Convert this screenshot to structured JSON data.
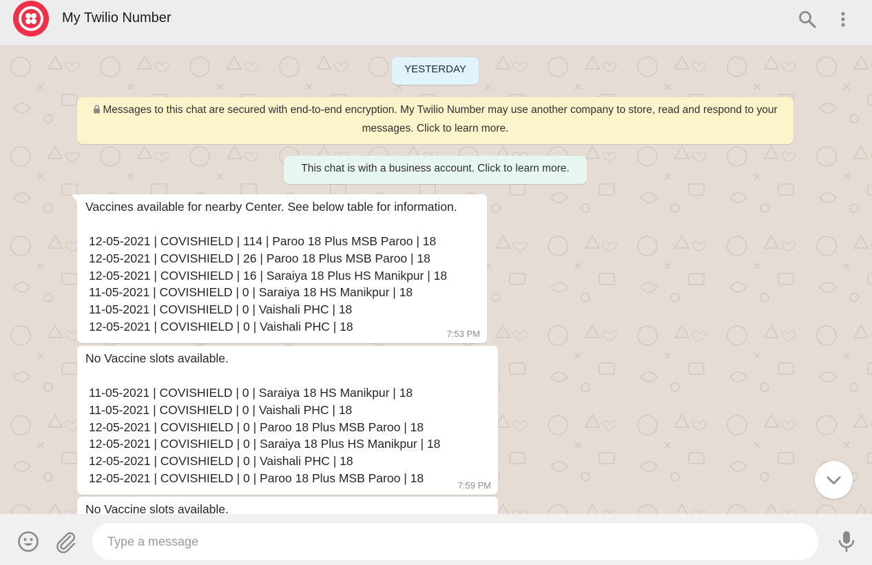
{
  "header": {
    "title": "My Twilio Number",
    "avatar": "twilio-logo",
    "brand_color": "#f22f46",
    "actions": [
      "search-icon",
      "more-vertical-icon"
    ]
  },
  "chat": {
    "date_pill": "YESTERDAY",
    "encryption_notice": "Messages to this chat are secured with end-to-end encryption. My Twilio Number may use another company to store, read and respond to your messages. Click to learn more.",
    "business_notice": "This chat is with a business account. Click to learn more.",
    "messages": [
      {
        "intro": "Vaccines available for nearby Center. See below table for information.",
        "rows": [
          "12-05-2021 | COVISHIELD | 114 | Paroo 18 Plus MSB Paroo | 18",
          "12-05-2021 | COVISHIELD | 26 | Paroo 18 Plus MSB Paroo | 18",
          "12-05-2021 | COVISHIELD | 16 | Saraiya 18 Plus HS Manikpur | 18",
          "11-05-2021 | COVISHIELD | 0 | Saraiya 18 HS Manikpur | 18",
          "11-05-2021 | COVISHIELD | 0 | Vaishali PHC | 18",
          "12-05-2021 | COVISHIELD | 0 | Vaishali PHC | 18"
        ],
        "time": "7:53 PM"
      },
      {
        "intro": "No Vaccine slots available.",
        "rows": [
          "11-05-2021 | COVISHIELD | 0 | Saraiya 18 HS Manikpur | 18",
          "11-05-2021 | COVISHIELD | 0 | Vaishali PHC | 18",
          "12-05-2021 | COVISHIELD | 0 | Paroo 18 Plus MSB Paroo | 18",
          "12-05-2021 | COVISHIELD | 0 | Saraiya 18 Plus HS Manikpur | 18",
          "12-05-2021 | COVISHIELD | 0 | Vaishali PHC | 18",
          "12-05-2021 | COVISHIELD | 0 | Paroo 18 Plus MSB Paroo | 18"
        ],
        "time": "7:59 PM"
      },
      {
        "intro": "No Vaccine slots available."
      }
    ]
  },
  "composer": {
    "placeholder": "Type a message",
    "icons": [
      "emoji-icon",
      "attach-icon",
      "microphone-icon"
    ]
  }
}
